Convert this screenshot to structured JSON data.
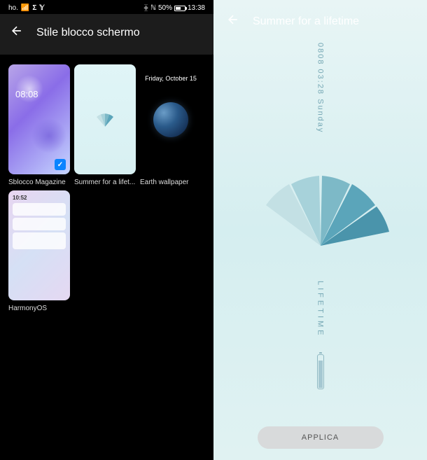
{
  "left": {
    "status": {
      "carrier": "ho.",
      "battery_pct": "50%",
      "time": "13:38"
    },
    "header": {
      "title": "Stile blocco schermo"
    },
    "themes": [
      {
        "label": "Sblocco Magazine",
        "selected": true,
        "thumb_time": "08:08"
      },
      {
        "label": "Summer for a lifet...",
        "selected": false
      },
      {
        "label": "Earth wallpaper",
        "selected": false
      },
      {
        "label": "HarmonyOS",
        "selected": false,
        "thumb_time": "10:52"
      }
    ]
  },
  "right": {
    "header": {
      "title": "Summer for a lifetime"
    },
    "preview": {
      "date_text": "0808  03:28  Sunday",
      "lifetime_text": "LIFETIME",
      "battery_small": "82%"
    },
    "apply_button": "APPLICA"
  },
  "colors": {
    "fan_shades": [
      "#c3e0e4",
      "#a7d2da",
      "#7db9c7",
      "#5ba5ba",
      "#4a94ab"
    ]
  }
}
